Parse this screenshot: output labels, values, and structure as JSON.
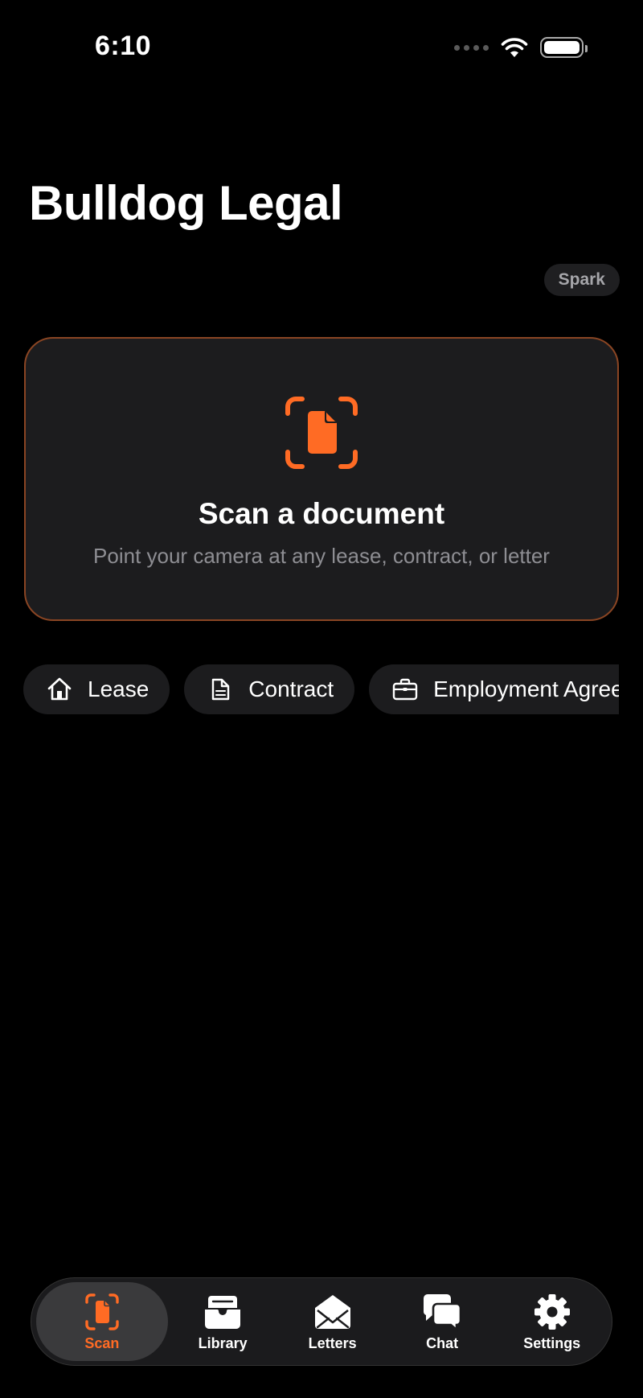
{
  "status_bar": {
    "time": "6:10"
  },
  "header": {
    "title": "Bulldog Legal",
    "badge": "Spark"
  },
  "scan_card": {
    "title": "Scan a document",
    "subtitle": "Point your camera at any lease, contract, or letter",
    "icon": "doc-viewfinder-icon"
  },
  "chips": [
    {
      "label": "Lease",
      "icon": "house-icon"
    },
    {
      "label": "Contract",
      "icon": "document-icon"
    },
    {
      "label": "Employment Agreement",
      "icon": "briefcase-icon"
    }
  ],
  "tab_bar": {
    "items": [
      {
        "label": "Scan",
        "icon": "doc-viewfinder-icon",
        "active": true
      },
      {
        "label": "Library",
        "icon": "tray-icon",
        "active": false
      },
      {
        "label": "Letters",
        "icon": "envelope-icon",
        "active": false
      },
      {
        "label": "Chat",
        "icon": "chat-bubbles-icon",
        "active": false
      },
      {
        "label": "Settings",
        "icon": "gear-icon",
        "active": false
      }
    ]
  },
  "colors": {
    "accent": "#ff6b24",
    "background": "#000000",
    "card": "#1c1c1e",
    "card_border": "#8a4523",
    "secondary_text": "#8e8e93"
  }
}
